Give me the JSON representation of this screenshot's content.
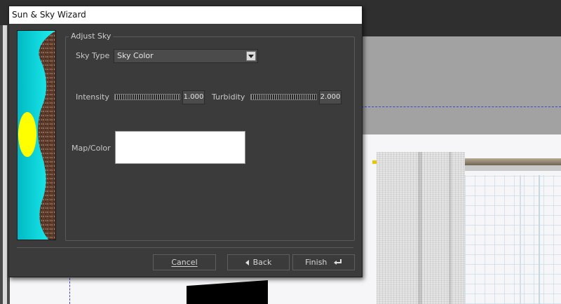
{
  "dialog": {
    "title": "Sun & Sky Wizard"
  },
  "group": {
    "legend": "Adjust Sky"
  },
  "sky_type": {
    "label": "Sky Type",
    "selected": "Sky Color"
  },
  "intensity": {
    "label": "Intensity",
    "value": "1.000"
  },
  "turbidity": {
    "label": "Turbidity",
    "value": "2.000"
  },
  "map_color": {
    "label": "Map/Color",
    "swatch_color": "#ffffff"
  },
  "buttons": {
    "cancel": "Cancel",
    "back": "Back",
    "finish": "Finish"
  },
  "icons": [
    "chevron-down-icon",
    "back-arrow-icon",
    "enter-icon"
  ],
  "colors": {
    "sky_preview_sky": "#00cdd4",
    "sky_preview_sun": "#ffff00",
    "sky_preview_ground": "#5a3a2a"
  }
}
